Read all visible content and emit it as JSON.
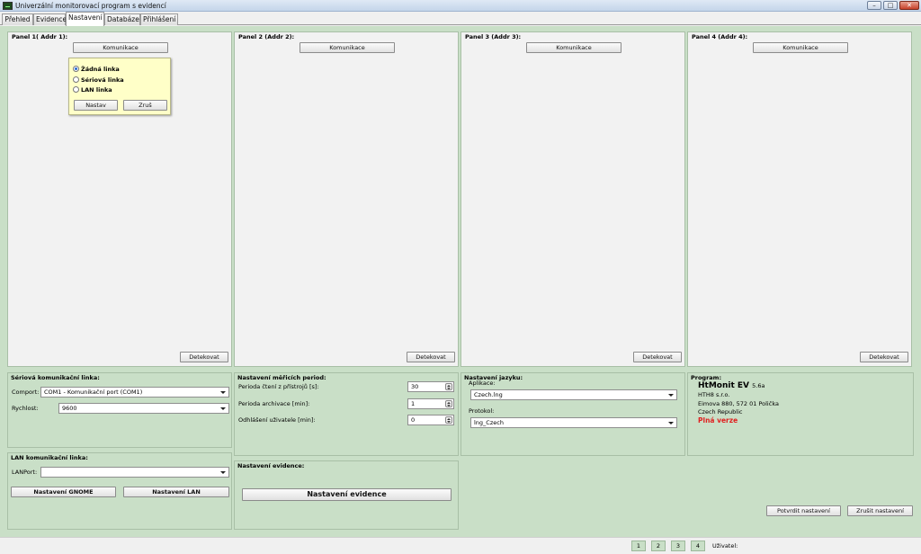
{
  "window": {
    "title": "Univerzální monitorovací program s evidencí"
  },
  "tabs": [
    "Přehled",
    "Evidence",
    "Nastavení",
    "Databáze",
    "Přihlášení"
  ],
  "panels": {
    "p1": {
      "title": "Panel 1( Addr 1):",
      "comm": "Komunikace",
      "detect": "Detekovat"
    },
    "p2": {
      "title": "Panel 2 (Addr 2):",
      "comm": "Komunikace",
      "detect": "Detekovat"
    },
    "p3": {
      "title": "Panel 3 (Addr 3):",
      "comm": "Komunikace",
      "detect": "Detekovat"
    },
    "p4": {
      "title": "Panel 4 (Addr 4):",
      "comm": "Komunikace",
      "detect": "Detekovat"
    }
  },
  "popup": {
    "options": [
      "Žádná linka",
      "Sériová linka",
      "LAN linka"
    ],
    "selected_index": 0,
    "ok": "Nastav",
    "cancel": "Zruš"
  },
  "serial": {
    "title": "Sériová komunikační linka:",
    "comport_label": "Comport:",
    "comport_value": "COM1 - Komunikační port (COM1)",
    "speed_label": "Rychlost:",
    "speed_value": "9600"
  },
  "periods": {
    "title": "Nastavení měřicích period:",
    "read_label": "Perioda čtení z přístrojů [s]:",
    "read_value": "30",
    "archive_label": "Perioda archivace [min]:",
    "archive_value": "1",
    "logout_label": "Odhlášení uživatele [min]:",
    "logout_value": "0"
  },
  "language": {
    "title": "Nastavení jazyku:",
    "app_label": "Aplikace:",
    "app_value": "Czech.lng",
    "proto_label": "Protokol:",
    "proto_value": "lng_Czech"
  },
  "program": {
    "title": "Program:",
    "name": "HtMonit EV",
    "version": "5.6a",
    "company": "HTH8 s.r.o.",
    "address": "Eimova 880, 572 01 Polička",
    "country": "Czech Republic",
    "license": "Plná verze",
    "license_color": "#e02020"
  },
  "lan": {
    "title": "LAN komunikační linka:",
    "port_label": "LANPort:",
    "port_value": "",
    "gnome_button": "Nastavení GNOME",
    "lan_button": "Nastavení LAN"
  },
  "evidence": {
    "title": "Nastavení evidence:",
    "button": "Nastavení evidence"
  },
  "actions": {
    "confirm": "Potvrdit nastavení",
    "cancel": "Zrušit nastavení"
  },
  "status": {
    "pages": [
      "1",
      "2",
      "3",
      "4"
    ],
    "user_label": "Uživatel:"
  }
}
